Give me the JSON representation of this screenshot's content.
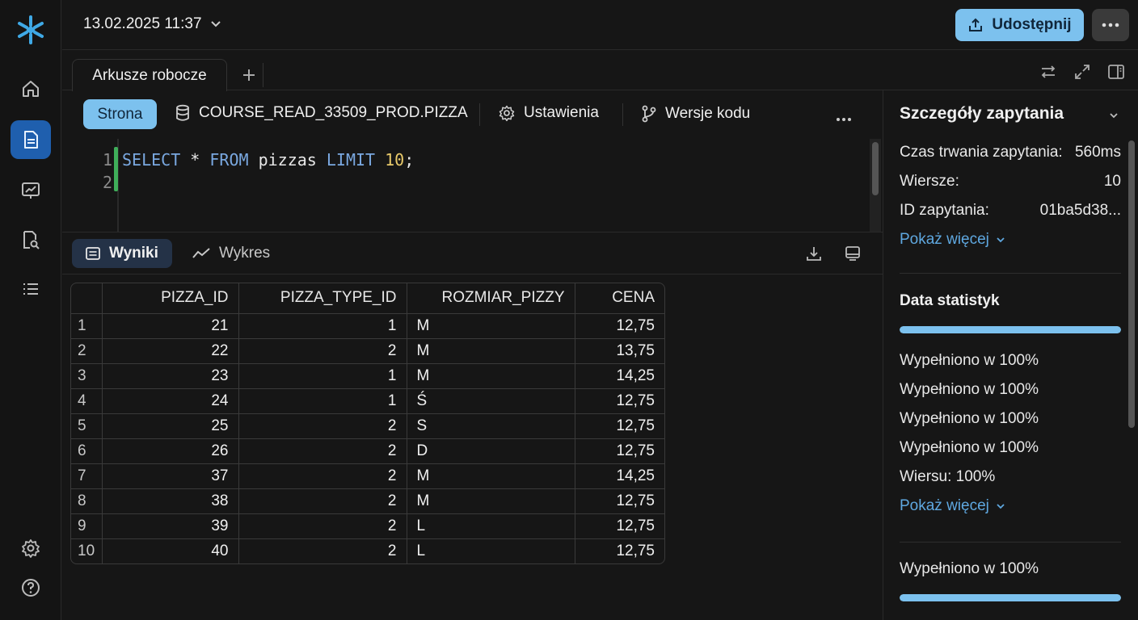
{
  "topbar": {
    "date_label": "13.02.2025 11:37",
    "share_label": "Udostępnij"
  },
  "tabs": {
    "active_tab": "Arkusze robocze"
  },
  "toolbar": {
    "context_button": "Strona",
    "database": "COURSE_READ_33509_PROD.PIZZA",
    "settings": "Ustawienia",
    "versions": "Wersje kodu"
  },
  "editor": {
    "line_numbers": "1\n2",
    "query_tokens": {
      "select": "SELECT",
      "star": " * ",
      "from": "FROM",
      "table": " pizzas ",
      "limit": "LIMIT",
      "space": " ",
      "number": "10",
      "semicolon": ";"
    }
  },
  "results": {
    "tab_results": "Wyniki",
    "tab_chart": "Wykres",
    "columns": [
      "",
      "PIZZA_ID",
      "PIZZA_TYPE_ID",
      "ROZMIAR_PIZZY",
      "CENA"
    ],
    "rows": [
      [
        "1",
        "21",
        "1",
        "M",
        "12,75"
      ],
      [
        "2",
        "22",
        "2",
        "M",
        "13,75"
      ],
      [
        "3",
        "23",
        "1",
        "M",
        "14,25"
      ],
      [
        "4",
        "24",
        "1",
        "Ś",
        "12,75"
      ],
      [
        "5",
        "25",
        "2",
        "S",
        "12,75"
      ],
      [
        "6",
        "26",
        "2",
        "D",
        "12,75"
      ],
      [
        "7",
        "37",
        "2",
        "M",
        "14,25"
      ],
      [
        "8",
        "38",
        "2",
        "M",
        "12,75"
      ],
      [
        "9",
        "39",
        "2",
        "L",
        "12,75"
      ],
      [
        "10",
        "40",
        "2",
        "L",
        "12,75"
      ]
    ]
  },
  "panel": {
    "title": "Szczegóły zapytania",
    "duration_label": "Czas trwania zapytania:",
    "duration_value": "560ms",
    "rows_label": "Wiersze:",
    "rows_value": "10",
    "query_id_label": "ID zapytania:",
    "query_id_value": "01ba5d38...",
    "show_more_1": "Pokaż więcej",
    "stats_title": "Data statistyk",
    "stats_bar_1": 1.0,
    "stat_lines": [
      "Wypełniono w 100%",
      "Wypełniono w 100%",
      "Wypełniono w 100%",
      "Wypełniono w 100%",
      "Wiersu: 100%"
    ],
    "show_more_2": "Pokaż więcej",
    "bottom_text": "Wypełniono w 100%",
    "stats_bar_2": 1.0
  }
}
